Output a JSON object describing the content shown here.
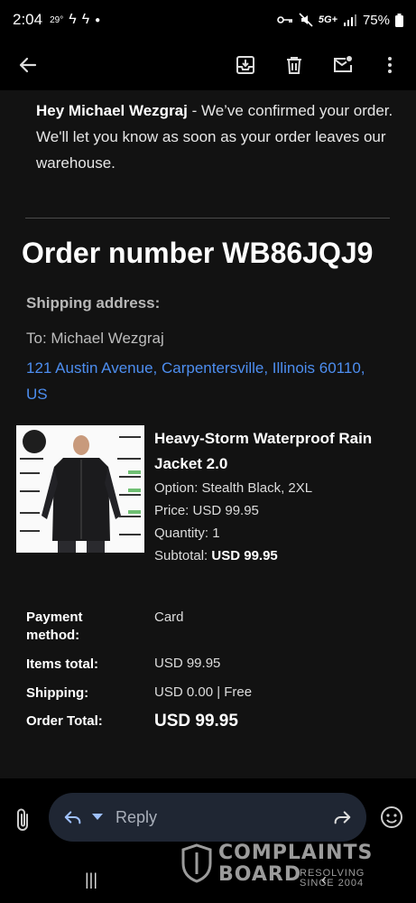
{
  "status_bar": {
    "time": "2:04",
    "temp": "29°",
    "network": "5G+",
    "battery": "75%"
  },
  "toolbar": {
    "back_icon": "arrow-left-icon",
    "archive_icon": "archive-icon",
    "delete_icon": "trash-icon",
    "mark_unread_icon": "mail-unread-icon",
    "more_icon": "more-vert-icon"
  },
  "email": {
    "greeting_name": "Hey Michael Wezgraj",
    "greeting_rest": " - We’ve confirmed your order. We'll let you know as soon as your order leaves our warehouse.",
    "order_title": "Order number WB86JQJ9",
    "shipping_label": "Shipping address:",
    "ship_to": "To: Michael Wezgraj",
    "ship_address": "121 Austin Avenue, Carpentersville, Illinois 60110, US",
    "product": {
      "name": "Heavy-Storm Waterproof Rain Jacket 2.0",
      "option": "Option: Stealth Black, 2XL",
      "price": "Price: USD 99.95",
      "quantity": "Quantity: 1",
      "subtotal_label": "Subtotal: ",
      "subtotal_value": "USD 99.95"
    },
    "payment": {
      "method_label": "Payment method:",
      "method_value": "Card",
      "items_label": "Items total:",
      "items_value": "USD 99.95",
      "shipping_label": "Shipping:",
      "shipping_value": "USD 0.00 | Free",
      "total_label": "Order Total:",
      "total_value": "USD 99.95"
    }
  },
  "reply": {
    "placeholder": "Reply"
  },
  "watermark": {
    "line1": "COMPLAINTS",
    "line2": "BOARD",
    "line3": "RESOLVING SINCE 2004"
  },
  "colors": {
    "link": "#4d8ef0",
    "background": "#121212",
    "reply_pill": "#1f2633"
  }
}
